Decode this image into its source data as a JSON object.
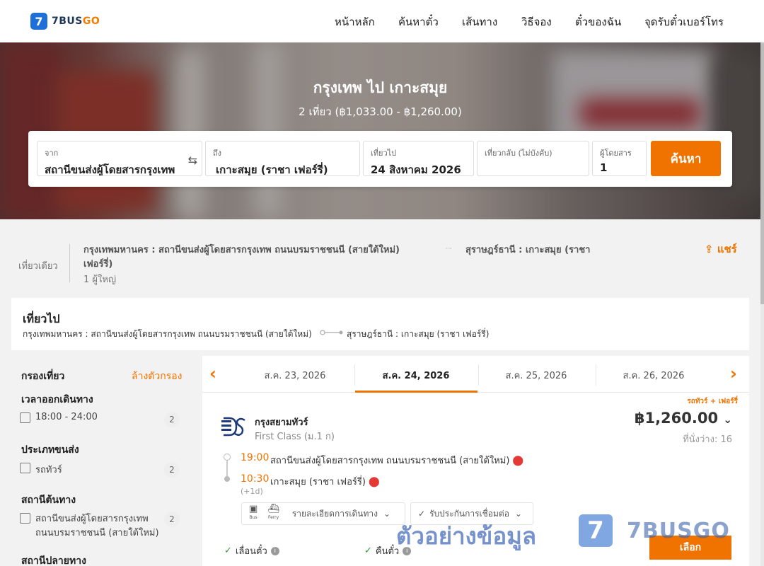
{
  "header": {
    "logo_mark": "7",
    "logo_text_a": "7BUS",
    "logo_text_b": "GO",
    "nav": [
      "หน้าหลัก",
      "ค้นหาตั๋ว",
      "เส้นทาง",
      "วิธีจอง",
      "ตั๋วของฉัน",
      "จุดรับตั๋วเบอร์โทร"
    ]
  },
  "hero": {
    "title": "กรุงเทพ ไป เกาะสมุย",
    "subtitle": "2 เที่ยว (฿1,033.00 - ฿1,260.00)"
  },
  "search": {
    "from_label": "จาก",
    "from_value": "สถานีขนส่งผู้โดยสารกรุงเทพ",
    "to_label": "ถึง",
    "to_value": "เกาะสมุย (ราชา เฟอร์รี่)",
    "depart_label": "เที่ยวไป",
    "depart_value": "24 สิงหาคม 2026",
    "return_label": "เที่ยวกลับ (ไม่บังคับ)",
    "return_value": "",
    "pax_label": "ผู้โดยสาร",
    "pax_value": "1",
    "button": "ค้นหา"
  },
  "summary": {
    "trip_type": "เที่ยวเดียว",
    "from": "กรุงเทพมหานคร : สถานีขนส่งผู้โดยสารกรุงเทพ ถนนบรมราชชนนี (สายใต้ใหม่)",
    "to_line1": "สุราษฎร์ธานี : เกาะสมุย (ราชา",
    "to_line2": "เฟอร์รี่)",
    "pax": "1 ผู้ใหญ่",
    "share": "แชร์"
  },
  "outbound": {
    "title": "เที่ยวไป",
    "from": "กรุงเทพมหานคร : สถานีขนส่งผู้โดยสารกรุงเทพ ถนนบรมราชชนนี (สายใต้ใหม่)",
    "to": "สุราษฎร์ธานี : เกาะสมุย (ราชา เฟอร์รี่)"
  },
  "filters": {
    "title": "กรองเที่ยว",
    "clear": "ล้างตัวกรอง",
    "groups": [
      {
        "name": "เวลาออกเดินทาง",
        "option": "18:00 - 24:00",
        "count": "2"
      },
      {
        "name": "ประเภทขนส่ง",
        "option": "รถทัวร์",
        "count": "2"
      },
      {
        "name": "สถานีต้นทาง",
        "option_line1": "สถานีขนส่งผู้โดยสารกรุงเทพ",
        "option_line2": "ถนนบรมราชชนนี (สายใต้ใหม่)",
        "count": "2"
      },
      {
        "name": "สถานีปลายทาง"
      }
    ]
  },
  "dates": {
    "tabs": [
      "ส.ค. 23, 2026",
      "ส.ค. 24, 2026",
      "ส.ค. 25, 2026",
      "ส.ค. 26, 2026"
    ],
    "active_index": 1
  },
  "result": {
    "tag": "รถทัวร์ + เฟอร์รี่",
    "operator": "กรุงสยามทัวร์",
    "class": "First Class (ม.1 ก)",
    "price": "฿1,260.00",
    "seats": "ที่นั่งว่าง: 16",
    "depart_time": "19:00",
    "depart_place": "สถานีขนส่งผู้โดยสารกรุงเทพ ถนนบรมราชชนนี (สายใต้ใหม่)",
    "arrive_time": "10:30",
    "arrive_place": "เกาะสมุย (ราชา เฟอร์รี่)",
    "next_day": "(+1d)",
    "bus_caption": "Bus",
    "ferry_caption": "Ferry",
    "details": "รายละเอียดการเดินทาง",
    "guarantee": "รับประกันการเชื่อมต่อ",
    "feature_change": "เลื่อนตั๋ว",
    "feature_refund": "คืนตั๋ว",
    "select": "เลือก"
  },
  "watermark": {
    "text": "ตัวอย่างข้อมูล",
    "logo": "7",
    "brand": "7BUSGO"
  },
  "colors": {
    "accent": "#f07300",
    "brand_blue": "#1f6fd8"
  }
}
